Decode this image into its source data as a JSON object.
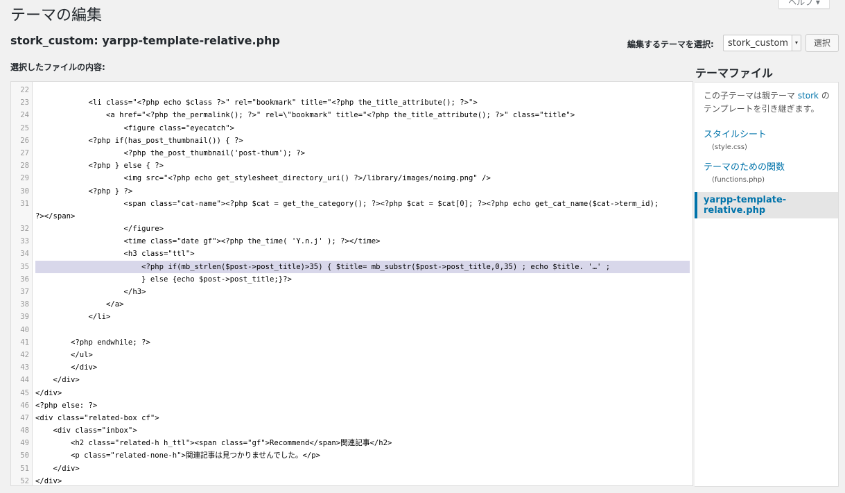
{
  "header": {
    "page_title": "テーマの編集",
    "help_label": "ヘルプ ▾",
    "file_title": "stork_custom: yarpp-template-relative.php",
    "select_label": "編集するテーマを選択:",
    "selected_theme": "stork_custom",
    "select_button": "選択",
    "content_label": "選択したファイルの内容:"
  },
  "editor": {
    "lines": [
      {
        "n": "22",
        "t": ""
      },
      {
        "n": "23",
        "t": "            <li class=\"<?php echo $class ?>\" rel=\"bookmark\" title=\"<?php the_title_attribute(); ?>\">"
      },
      {
        "n": "24",
        "t": "                <a href=\"<?php the_permalink(); ?>\" rel=\\\"bookmark\" title=\"<?php the_title_attribute(); ?>\" class=\"title\">"
      },
      {
        "n": "25",
        "t": "                    <figure class=\"eyecatch\">"
      },
      {
        "n": "26",
        "t": "            <?php if(has_post_thumbnail()) { ?>"
      },
      {
        "n": "27",
        "t": "                    <?php the_post_thumbnail('post-thum'); ?>"
      },
      {
        "n": "28",
        "t": "            <?php } else { ?>"
      },
      {
        "n": "29",
        "t": "                    <img src=\"<?php echo get_stylesheet_directory_uri() ?>/library/images/noimg.png\" />"
      },
      {
        "n": "30",
        "t": "            <?php } ?>"
      },
      {
        "n": "31",
        "t": "                    <span class=\"cat-name\"><?php $cat = get_the_category(); ?><?php $cat = $cat[0]; ?><?php echo get_cat_name($cat->term_id);"
      },
      {
        "n": "",
        "t": "?></span>"
      },
      {
        "n": "32",
        "t": "                    </figure>"
      },
      {
        "n": "33",
        "t": "                    <time class=\"date gf\"><?php the_time( 'Y.n.j' ); ?></time>"
      },
      {
        "n": "34",
        "t": "                    <h3 class=\"ttl\">"
      },
      {
        "n": "35",
        "t": "                        <?php if(mb_strlen($post->post_title)>35) { $title= mb_substr($post->post_title,0,35) ; echo $title. '…' ;",
        "hl": true
      },
      {
        "n": "36",
        "t": "                        } else {echo $post->post_title;}?>"
      },
      {
        "n": "37",
        "t": "                    </h3>"
      },
      {
        "n": "38",
        "t": "                </a>"
      },
      {
        "n": "39",
        "t": "            </li>"
      },
      {
        "n": "40",
        "t": ""
      },
      {
        "n": "41",
        "t": "        <?php endwhile; ?>"
      },
      {
        "n": "42",
        "t": "        </ul>"
      },
      {
        "n": "43",
        "t": "        </div>"
      },
      {
        "n": "44",
        "t": "    </div>"
      },
      {
        "n": "45",
        "t": "</div>"
      },
      {
        "n": "46",
        "t": "<?php else: ?>"
      },
      {
        "n": "47",
        "t": "<div class=\"related-box cf\">"
      },
      {
        "n": "48",
        "t": "    <div class=\"inbox\">"
      },
      {
        "n": "49",
        "t": "        <h2 class=\"related-h h_ttl\"><span class=\"gf\">Recommend</span>関連記事</h2>"
      },
      {
        "n": "50",
        "t": "        <p class=\"related-none-h\">関連記事は見つかりませんでした。</p>"
      },
      {
        "n": "51",
        "t": "    </div>"
      },
      {
        "n": "52",
        "t": "</div>"
      }
    ]
  },
  "sidebar": {
    "title": "テーマファイル",
    "desc_prefix": "この子テーマは親テーマ ",
    "parent_theme": "stork",
    "desc_suffix": " のテンプレートを引き継ぎます。",
    "files": [
      {
        "name": "スタイルシート",
        "file": "(style.css)"
      },
      {
        "name": "テーマのための関数",
        "file": "(functions.php)"
      },
      {
        "name": "yarpp-template-relative.php",
        "file": ""
      }
    ]
  }
}
